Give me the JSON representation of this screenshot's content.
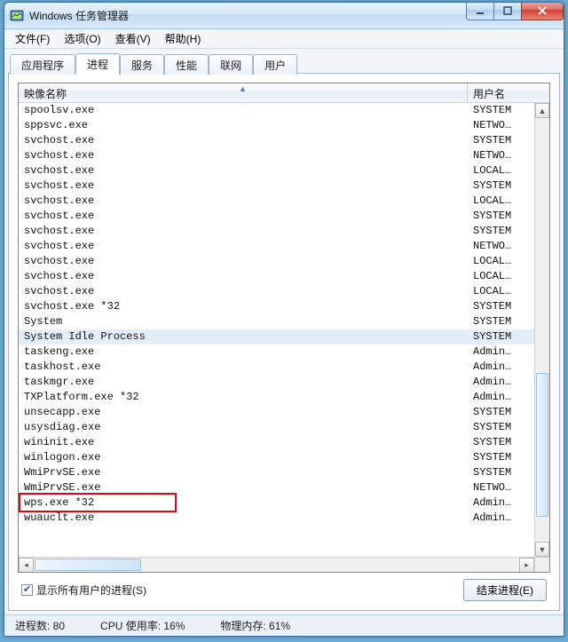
{
  "window": {
    "title": "Windows 任务管理器"
  },
  "menu": {
    "file": "文件(F)",
    "options": "选项(O)",
    "view": "查看(V)",
    "help": "帮助(H)"
  },
  "tabs": {
    "apps": "应用程序",
    "processes": "进程",
    "services": "服务",
    "performance": "性能",
    "networking": "联网",
    "users": "用户"
  },
  "columns": {
    "image": "映像名称",
    "user": "用户名"
  },
  "rows": [
    {
      "name": "spoolsv.exe",
      "user": "SYSTEM"
    },
    {
      "name": "sppsvc.exe",
      "user": "NETWO…"
    },
    {
      "name": "svchost.exe",
      "user": "SYSTEM"
    },
    {
      "name": "svchost.exe",
      "user": "NETWO…"
    },
    {
      "name": "svchost.exe",
      "user": "LOCAL…"
    },
    {
      "name": "svchost.exe",
      "user": "SYSTEM"
    },
    {
      "name": "svchost.exe",
      "user": "LOCAL…"
    },
    {
      "name": "svchost.exe",
      "user": "SYSTEM"
    },
    {
      "name": "svchost.exe",
      "user": "SYSTEM"
    },
    {
      "name": "svchost.exe",
      "user": "NETWO…"
    },
    {
      "name": "svchost.exe",
      "user": "LOCAL…"
    },
    {
      "name": "svchost.exe",
      "user": "LOCAL…"
    },
    {
      "name": "svchost.exe",
      "user": "LOCAL…"
    },
    {
      "name": "svchost.exe *32",
      "user": "SYSTEM"
    },
    {
      "name": "System",
      "user": "SYSTEM"
    },
    {
      "name": "System Idle Process",
      "user": "SYSTEM",
      "selected": true
    },
    {
      "name": "taskeng.exe",
      "user": "Admin…"
    },
    {
      "name": "taskhost.exe",
      "user": "Admin…"
    },
    {
      "name": "taskmgr.exe",
      "user": "Admin…"
    },
    {
      "name": "TXPlatform.exe *32",
      "user": "Admin…"
    },
    {
      "name": "unsecapp.exe",
      "user": "SYSTEM"
    },
    {
      "name": "usysdiag.exe",
      "user": "SYSTEM"
    },
    {
      "name": "wininit.exe",
      "user": "SYSTEM"
    },
    {
      "name": "winlogon.exe",
      "user": "SYSTEM"
    },
    {
      "name": "WmiPrvSE.exe",
      "user": "SYSTEM"
    },
    {
      "name": "WmiPrvSE.exe",
      "user": "NETWO…"
    },
    {
      "name": "wps.exe *32",
      "user": "Admin…",
      "highlight": true
    },
    {
      "name": "wuauclt.exe",
      "user": "Admin…"
    }
  ],
  "checkbox": {
    "label": "显示所有用户的进程(S)",
    "checked": true
  },
  "buttons": {
    "end": "结束进程(E)"
  },
  "status": {
    "processes": "进程数: 80",
    "cpu": "CPU 使用率: 16%",
    "mem": "物理内存: 61%"
  }
}
